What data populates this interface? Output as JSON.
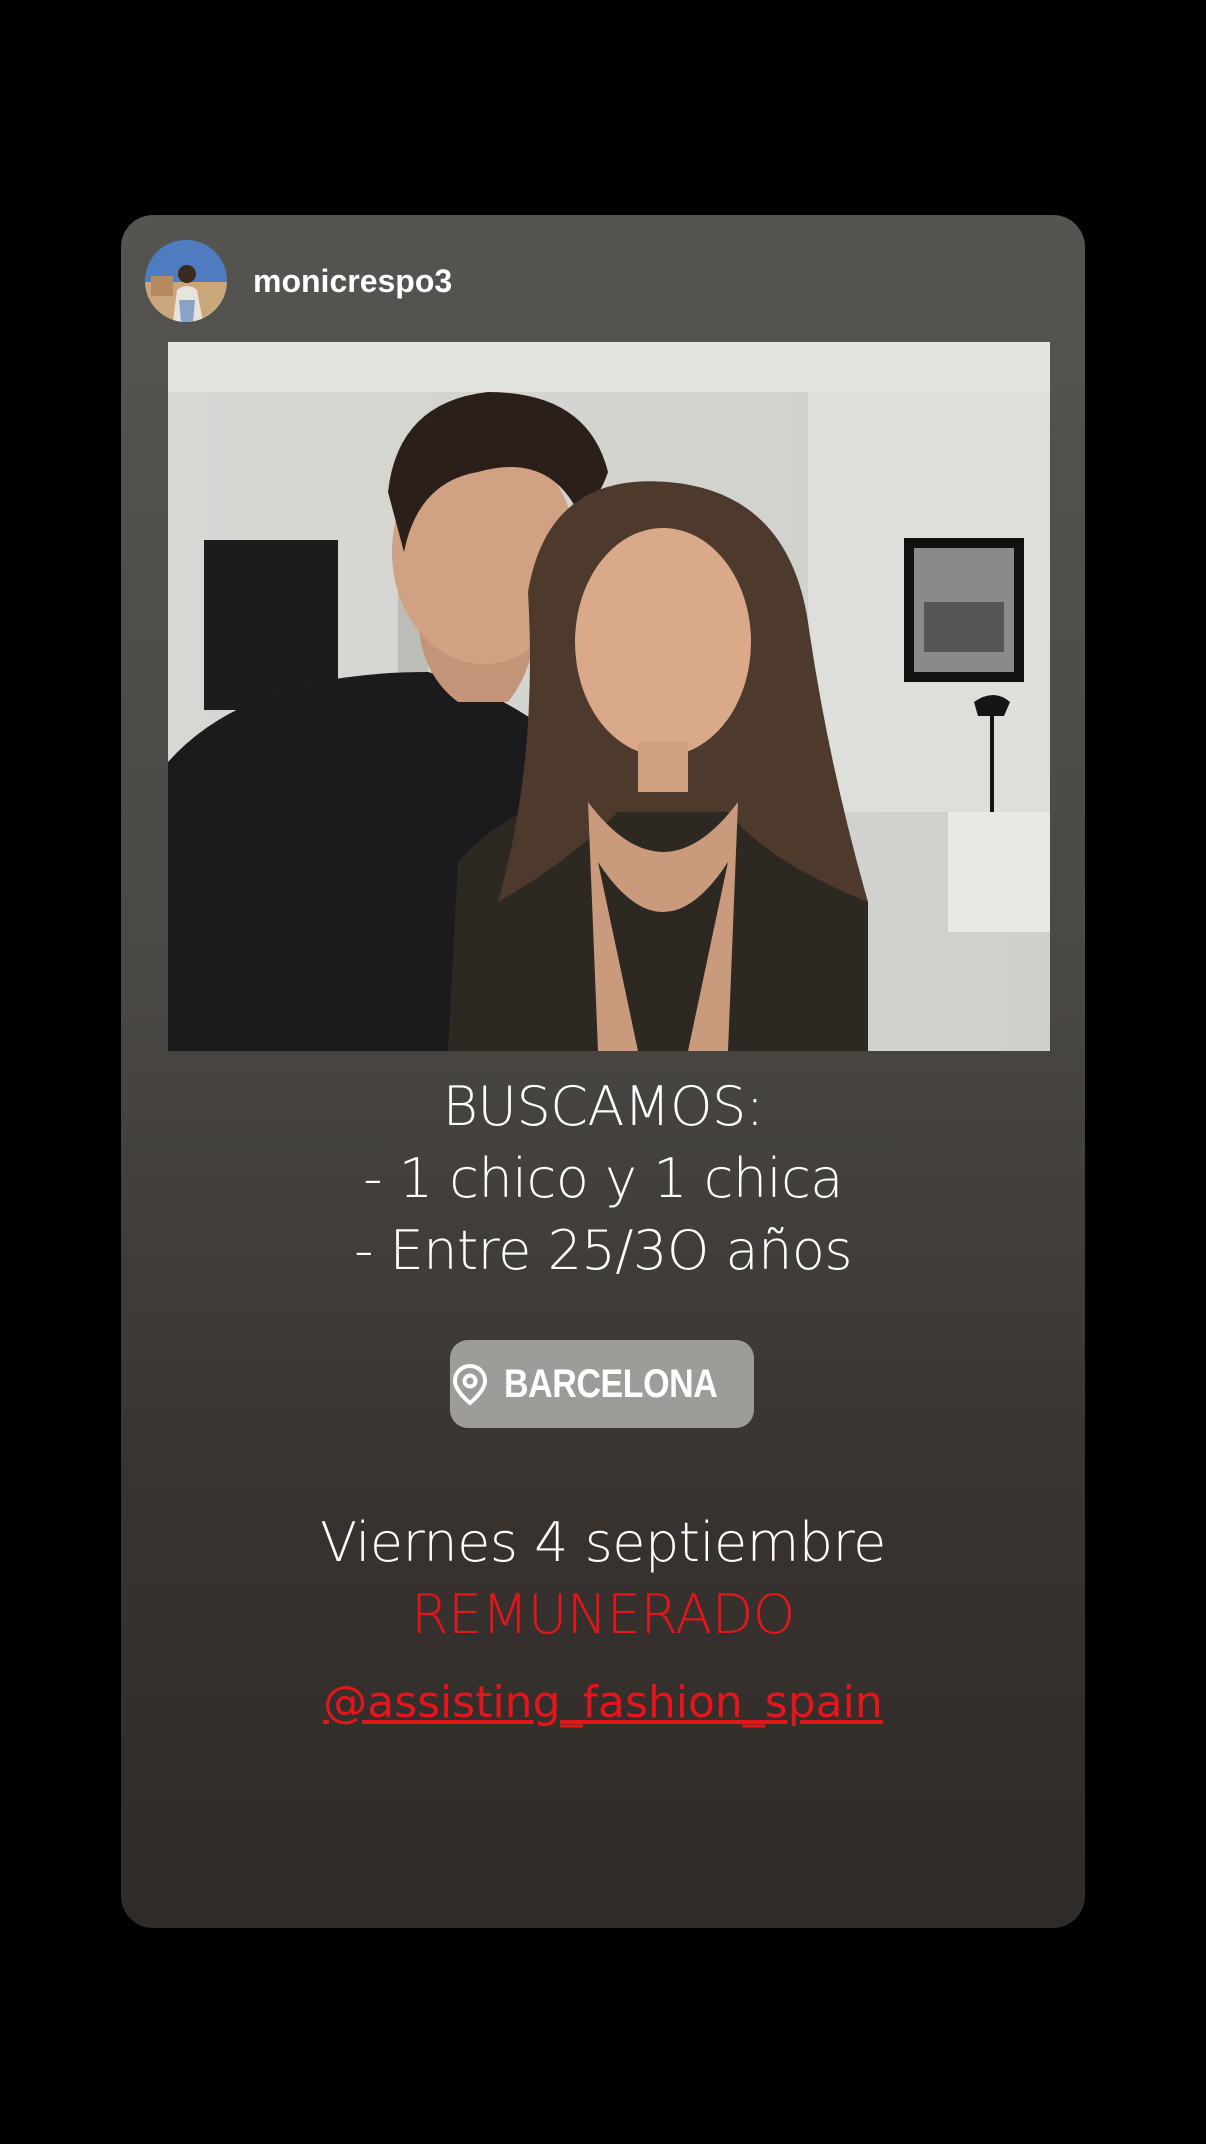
{
  "story": {
    "username": "monicrespo3",
    "lines": [
      "BUSCAMOS:",
      "- 1 chico y 1 chica",
      "- Entre 25/3O años"
    ],
    "location": "BARCELONA",
    "date": "Viernes 4 septiembre",
    "paid": "REMUNERADO",
    "mention": "@assisting_fashion_spain"
  },
  "colors": {
    "accent_red": "#e4161b",
    "pill_bg": "#9e9c99",
    "card_top": "#555450",
    "card_bottom": "#2f2b28"
  },
  "icons": [
    "location-pin-icon"
  ]
}
